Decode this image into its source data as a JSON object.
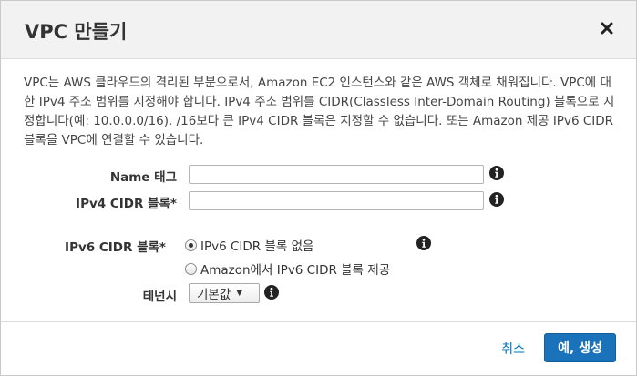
{
  "dialog": {
    "title": "VPC 만들기",
    "close_icon": "close-icon",
    "description": "VPC는 AWS 클라우드의 격리된 부분으로서, Amazon EC2 인스턴스와 같은 AWS 객체로 채워집니다. VPC에 대한 IPv4 주소 범위를 지정해야 합니다. IPv4 주소 범위를 CIDR(Classless Inter-Domain Routing) 블록으로 지정합니다(예: 10.0.0.0/16). /16보다 큰 IPv4 CIDR 블록은 지정할 수 없습니다. 또는 Amazon 제공 IPv6 CIDR 블록을 VPC에 연결할 수 있습니다."
  },
  "form": {
    "name_tag": {
      "label": "Name 태그",
      "value": "",
      "info_icon": "info-icon"
    },
    "ipv4_cidr": {
      "label": "IPv4 CIDR 블록*",
      "value": "",
      "info_icon": "info-icon"
    },
    "ipv6_cidr": {
      "label": "IPv6 CIDR 블록*",
      "options": [
        {
          "label": "IPv6 CIDR 블록 없음",
          "selected": true
        },
        {
          "label": "Amazon에서 IPv6 CIDR 블록 제공",
          "selected": false
        }
      ],
      "info_icon": "info-icon"
    },
    "tenancy": {
      "label": "테넌시",
      "selected": "기본값",
      "info_icon": "info-icon"
    }
  },
  "footer": {
    "cancel_label": "취소",
    "create_label": "예, 생성"
  },
  "colors": {
    "primary": "#1a73ba",
    "link": "#0073bb",
    "header_bg": "#f2f2f2"
  }
}
